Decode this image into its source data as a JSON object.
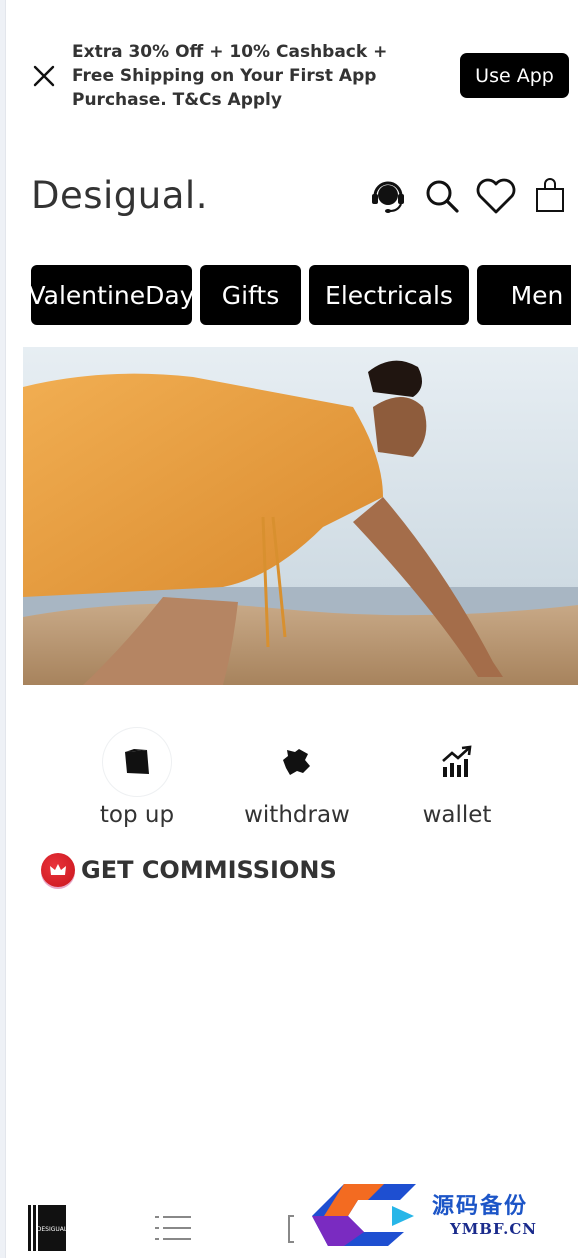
{
  "promo": {
    "message": "Extra 30% Off + 10% Cashback + Free Shipping on Your First App Purchase. T&Cs Apply",
    "cta": "Use App",
    "close_icon": "close-icon"
  },
  "header": {
    "brand": "Desigual.",
    "icons": [
      "support-headset-icon",
      "search-icon",
      "heart-icon",
      "shopping-bag-icon"
    ]
  },
  "categories": [
    "ValentineDay",
    "Gifts",
    "Electricals",
    "Men"
  ],
  "hero": {
    "icon": "hero-banner-image"
  },
  "actions": [
    {
      "label": "top up",
      "icon": "top-up-icon"
    },
    {
      "label": "withdraw",
      "icon": "withdraw-icon"
    },
    {
      "label": "wallet",
      "icon": "wallet-chart-icon"
    }
  ],
  "commissions": {
    "label": "GET COMMISSIONS",
    "icon": "crown-badge-icon"
  },
  "bottom_nav": {
    "logo_text": "DESIGUAL",
    "icons": [
      "home-logo-icon",
      "menu-list-icon",
      "bracket-icon"
    ]
  },
  "watermark": {
    "cn": "源码备份",
    "en": "YMBF.CN",
    "glyph": "码"
  },
  "colors": {
    "chip_bg": "#000000",
    "chip_text": "#ffffff",
    "accent_red": "#e02a32"
  }
}
